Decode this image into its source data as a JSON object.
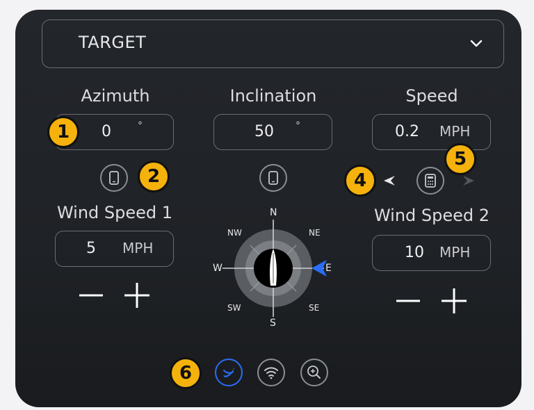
{
  "target": {
    "label": "TARGET",
    "chevron_icon": "chevron-down-icon"
  },
  "azimuth": {
    "title": "Azimuth",
    "value": "0",
    "unit": "°",
    "badge": "1"
  },
  "inclination": {
    "title": "Inclination",
    "value": "50",
    "unit": "°"
  },
  "speed": {
    "title": "Speed",
    "value": "0.2",
    "unit": "MPH"
  },
  "phone_buttons": {
    "icon": "phone-icon",
    "badge": "2"
  },
  "calculator": {
    "icon": "calculator-icon",
    "left_badge": "4",
    "top_badge": "5"
  },
  "wind_speed_1": {
    "title": "Wind Speed 1",
    "value": "5",
    "unit": "MPH",
    "minus": "−",
    "plus": "+"
  },
  "wind_speed_2": {
    "title": "Wind Speed 2",
    "value": "10",
    "unit": "MPH",
    "minus": "−",
    "plus": "+"
  },
  "compass": {
    "labels": {
      "n": "N",
      "ne": "NE",
      "e": "E",
      "se": "SE",
      "s": "S",
      "sw": "SW",
      "w": "W",
      "nw": "NW"
    },
    "pointer_direction": "E",
    "pointer_color": "#2a6ef5"
  },
  "bottom_bar": {
    "badge": "6",
    "buttons": [
      "swift-icon",
      "wifi-icon",
      "zoom-in-icon"
    ],
    "active_color": "#2a6ef5"
  },
  "colors": {
    "badge": "#f6b20c",
    "panel": "#23262b",
    "accent": "#2a6ef5"
  }
}
